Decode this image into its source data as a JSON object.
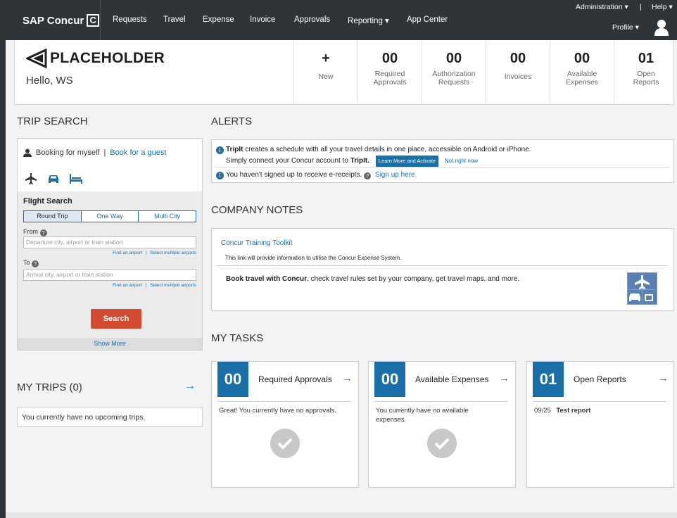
{
  "nav": {
    "brand": "SAP Concur",
    "brand_mark": "C",
    "items": [
      "Requests",
      "Travel",
      "Expense",
      "Invoice",
      "Approvals",
      "Reporting ▾",
      "App Center"
    ],
    "administration": "Administration ▾",
    "separator": "|",
    "help": "Help ▾",
    "profile": "Profile ▾"
  },
  "banner": {
    "logo_text": "PLACEHOLDER",
    "greeting": "Hello, WS",
    "stats": [
      {
        "num": "+",
        "label": "New"
      },
      {
        "num": "00",
        "label": "Required\nApprovals"
      },
      {
        "num": "00",
        "label": "Authorization\nRequests"
      },
      {
        "num": "00",
        "label": "Invoices"
      },
      {
        "num": "00",
        "label": "Available\nExpenses"
      },
      {
        "num": "01",
        "label": "Open\nReports"
      }
    ]
  },
  "trip_search": {
    "title": "TRIP SEARCH",
    "booking_self": "Booking for myself",
    "booking_sep": "|",
    "booking_guest": "Book for a guest",
    "flight_title": "Flight Search",
    "trip_types": [
      "Round Trip",
      "One Way",
      "Multi City"
    ],
    "from_label": "From",
    "from_placeholder": "Departure city, airport or train station",
    "to_label": "To",
    "to_placeholder": "Arrival city, airport or train station",
    "find_airport": "Find an airport",
    "links_sep": "|",
    "multi_airports": "Select multiple airports",
    "search_button": "Search",
    "show_more": "Show More"
  },
  "my_trips": {
    "title": "MY TRIPS (0)",
    "arrow": "→",
    "message": "You currently have no upcoming trips."
  },
  "alerts": {
    "title": "ALERTS",
    "tripit_bold": "TripIt",
    "tripit_text": " creates a schedule with all your travel details in one place, accessible on Android or iPhone.",
    "tripit_line2": "Simply connect your Concur account to ",
    "tripit_line2_bold": "TripIt.",
    "learn_more": "Learn More and Activate",
    "not_now": "Not right now",
    "ereceipt_text": "You haven't signed up to receive e-receipts.",
    "sign_up": "Sign up here"
  },
  "company_notes": {
    "title": "COMPANY NOTES",
    "link": "Concur Training Toolkit",
    "desc": "This link will provide information to utilise the Concur Expense System.",
    "book_bold": "Book travel with Concur",
    "book_text": ", check travel rules set by your company, get travel maps, and more."
  },
  "my_tasks": {
    "title": "MY TASKS",
    "tasks": [
      {
        "num": "00",
        "label": "Required Approvals",
        "arrow": "→",
        "message": "Great! You currently have no approvals."
      },
      {
        "num": "00",
        "label": "Available Expenses",
        "arrow": "→",
        "message": "You currently have no available expenses."
      },
      {
        "num": "01",
        "label": "Open Reports",
        "arrow": "→",
        "report_date": "09/25",
        "report_name": "Test report"
      }
    ]
  },
  "colors": {
    "nav_bg": "#2f3439",
    "accent": "#1a6fa8",
    "search_btn": "#d24a2f"
  }
}
